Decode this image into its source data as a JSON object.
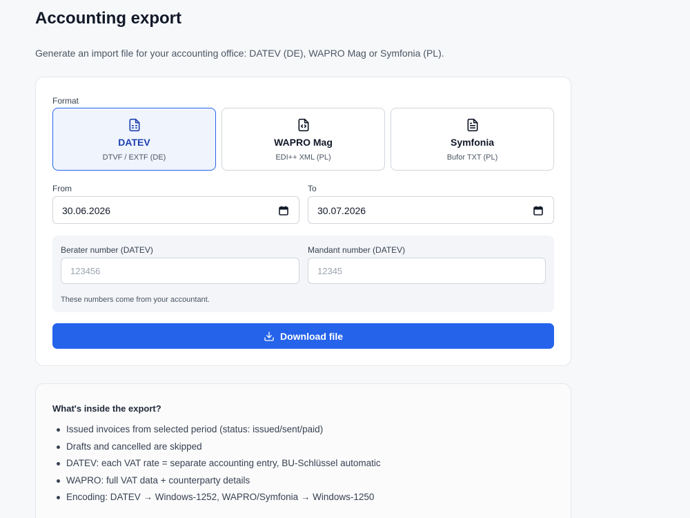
{
  "header": {
    "title": "Accounting export",
    "subtitle": "Generate an import file for your accounting office: DATEV (DE), WAPRO Mag or Symfonia (PL)."
  },
  "form": {
    "format_label": "Format",
    "formats": [
      {
        "name": "DATEV",
        "desc": "DTVF / EXTF (DE)",
        "icon": "spreadsheet-file-icon",
        "selected": true
      },
      {
        "name": "WAPRO Mag",
        "desc": "EDI++ XML (PL)",
        "icon": "code-file-icon",
        "selected": false
      },
      {
        "name": "Symfonia",
        "desc": "Bufor TXT (PL)",
        "icon": "text-file-icon",
        "selected": false
      }
    ],
    "from_label": "From",
    "from_value": "30.06.2026",
    "to_label": "To",
    "to_value": "30.07.2026",
    "berater_label": "Berater number (DATEV)",
    "berater_placeholder": "123456",
    "mandant_label": "Mandant number (DATEV)",
    "mandant_placeholder": "12345",
    "hint": "These numbers come from your accountant.",
    "download_label": "Download file"
  },
  "info": {
    "title": "What's inside the export?",
    "items": [
      "Issued invoices from selected period (status: issued/sent/paid)",
      "Drafts and cancelled are skipped",
      "DATEV: each VAT rate = separate accounting entry, BU-Schlüssel automatic",
      "WAPRO: full VAT data + counterparty details",
      "Encoding: DATEV → Windows-1252, WAPRO/Symfonia → Windows-1250"
    ]
  },
  "colors": {
    "accent": "#2563eb",
    "selected_bg": "#eff4fd",
    "background": "#f6f8fa"
  }
}
